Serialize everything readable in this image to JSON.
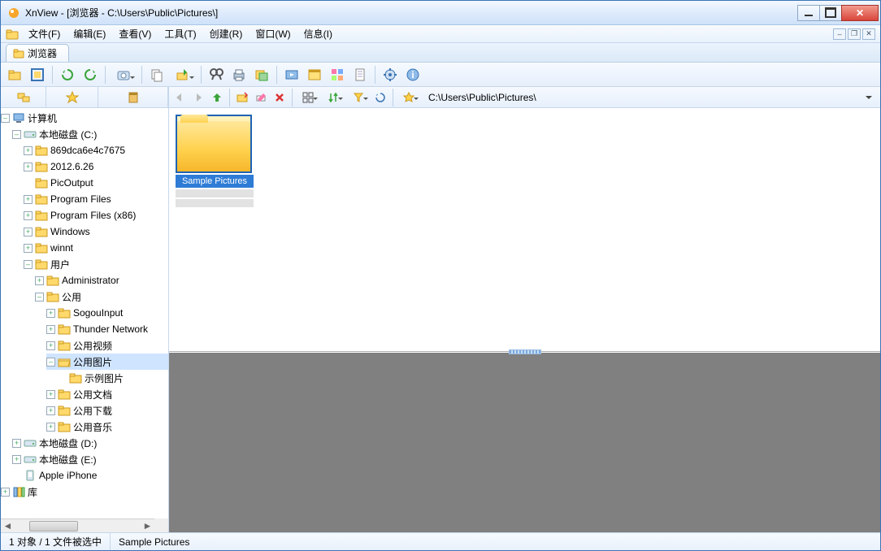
{
  "window": {
    "title": "XnView - [浏览器 - C:\\Users\\Public\\Pictures\\]"
  },
  "menu": {
    "items": [
      "文件(F)",
      "编辑(E)",
      "查看(V)",
      "工具(T)",
      "创建(R)",
      "窗口(W)",
      "信息(I)"
    ]
  },
  "tabs": {
    "browser": "浏览器"
  },
  "path": "C:\\Users\\Public\\Pictures\\",
  "tree": {
    "root": "计算机",
    "c": "本地磁盘 (C:)",
    "c_items": [
      "869dca6e4c7675",
      "2012.6.26",
      "PicOutput",
      "Program Files",
      "Program Files (x86)",
      "Windows",
      "winnt",
      "用户"
    ],
    "admin": "Administrator",
    "public": "公用",
    "public_items": [
      "SogouInput",
      "Thunder Network",
      "公用视频",
      "公用图片",
      "公用文档",
      "公用下载",
      "公用音乐"
    ],
    "sample": "示例图片",
    "d": "本地磁盘 (D:)",
    "e": "本地磁盘 (E:)",
    "iphone": "Apple iPhone",
    "lib": "库"
  },
  "thumbs": {
    "sample_label": "Sample Pictures"
  },
  "status": {
    "count": "1 对象 / 1 文件被选中",
    "sel": "Sample Pictures"
  }
}
